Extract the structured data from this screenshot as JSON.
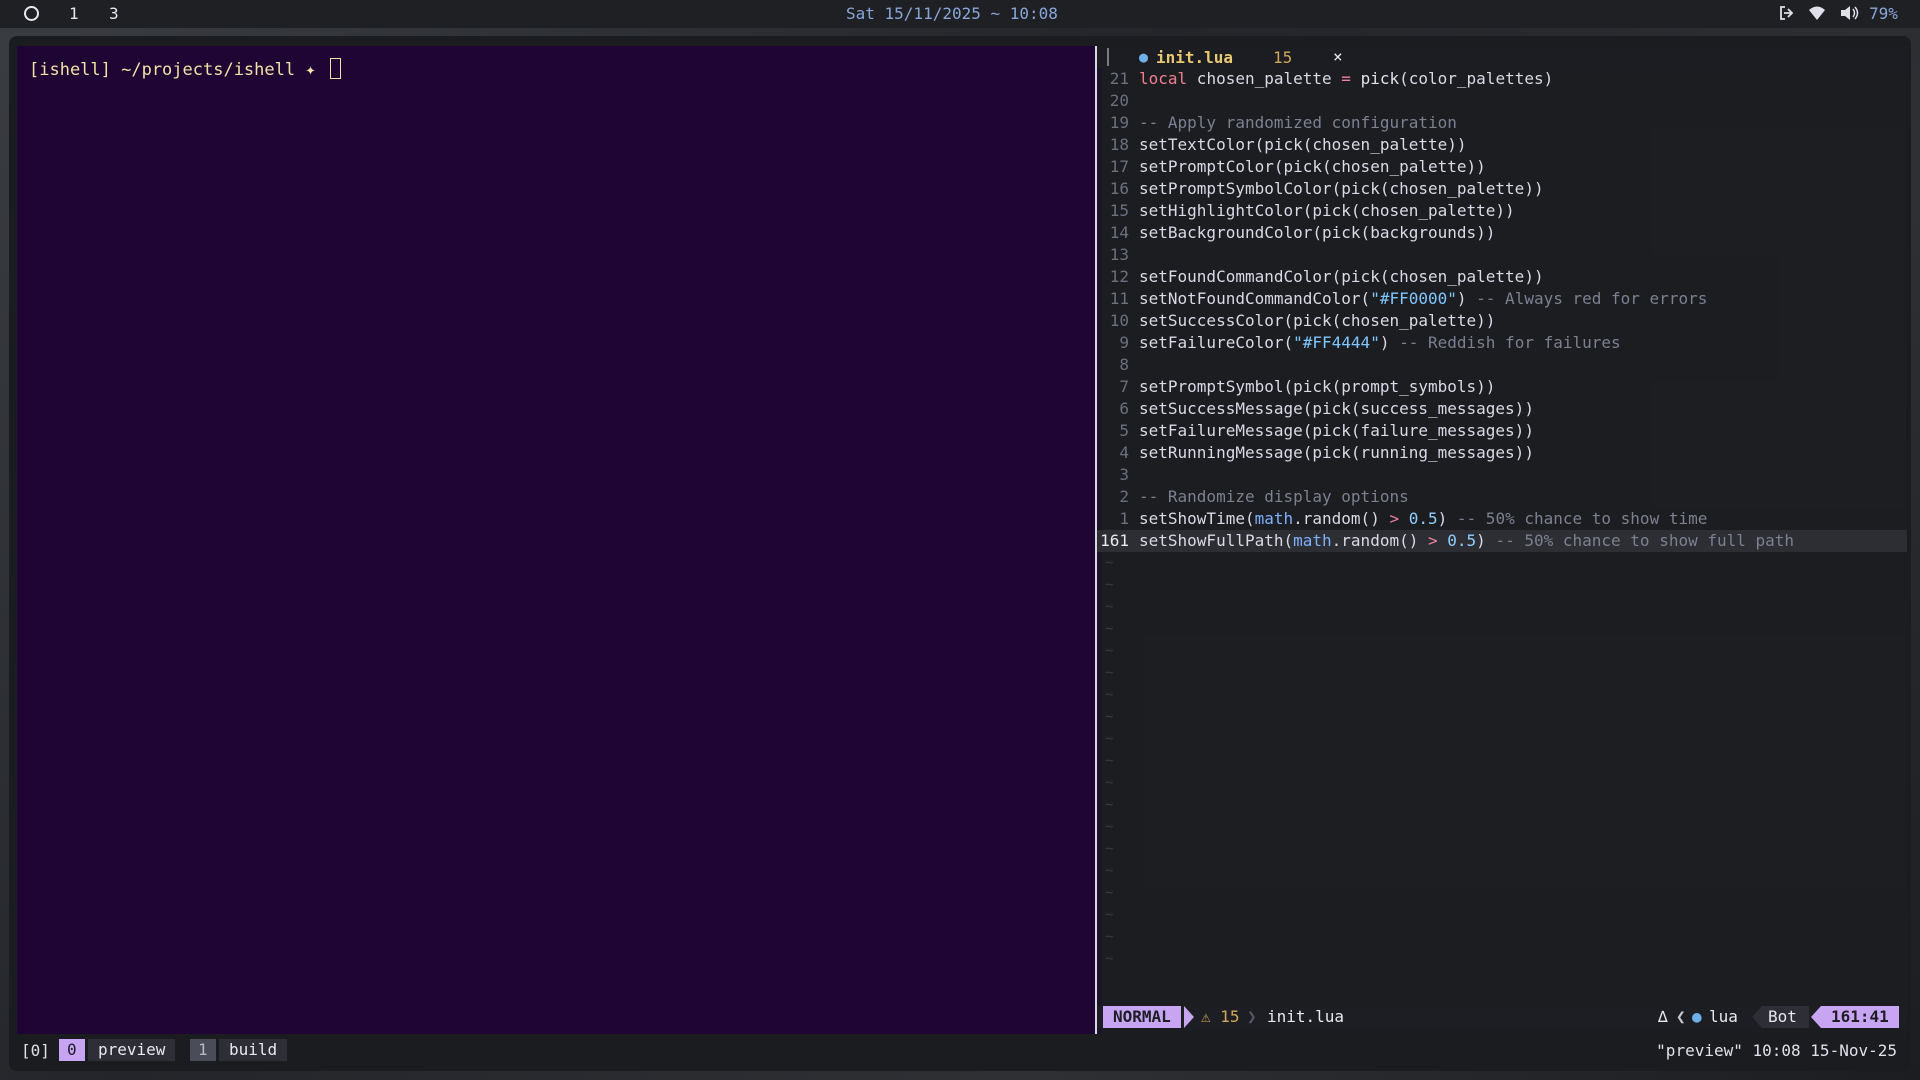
{
  "topbar": {
    "workspaces": [
      "1",
      "3"
    ],
    "clock": "Sat 15/11/2025 ~ 10:08",
    "battery": "79%",
    "tray_icons": [
      "logout-icon",
      "wifi-icon",
      "volume-icon"
    ]
  },
  "terminal": {
    "prompt": "[ishell] ~/projects/ishell ✦ "
  },
  "editor": {
    "tab": {
      "name": "init.lua",
      "diagnostics": "15",
      "close": "×"
    },
    "lines": [
      {
        "ln": "21",
        "code": "local chosen_palette = pick(color_palettes)"
      },
      {
        "ln": "20",
        "code": ""
      },
      {
        "ln": "19",
        "code": "-- Apply randomized configuration"
      },
      {
        "ln": "18",
        "code": "setTextColor(pick(chosen_palette))"
      },
      {
        "ln": "17",
        "code": "setPromptColor(pick(chosen_palette))"
      },
      {
        "ln": "16",
        "code": "setPromptSymbolColor(pick(chosen_palette))"
      },
      {
        "ln": "15",
        "code": "setHighlightColor(pick(chosen_palette))"
      },
      {
        "ln": "14",
        "code": "setBackgroundColor(pick(backgrounds))"
      },
      {
        "ln": "13",
        "code": ""
      },
      {
        "ln": "12",
        "code": "setFoundCommandColor(pick(chosen_palette))"
      },
      {
        "ln": "11",
        "code": "setNotFoundCommandColor(\"#FF0000\") -- Always red for errors"
      },
      {
        "ln": "10",
        "code": "setSuccessColor(pick(chosen_palette))"
      },
      {
        "ln": "9",
        "code": "setFailureColor(\"#FF4444\") -- Reddish for failures"
      },
      {
        "ln": "8",
        "code": ""
      },
      {
        "ln": "7",
        "code": "setPromptSymbol(pick(prompt_symbols))"
      },
      {
        "ln": "6",
        "code": "setSuccessMessage(pick(success_messages))"
      },
      {
        "ln": "5",
        "code": "setFailureMessage(pick(failure_messages))"
      },
      {
        "ln": "4",
        "code": "setRunningMessage(pick(running_messages))"
      },
      {
        "ln": "3",
        "code": ""
      },
      {
        "ln": "2",
        "code": "-- Randomize display options"
      },
      {
        "ln": "1",
        "code": "setShowTime(math.random() > 0.5) -- 50% chance to show time"
      },
      {
        "ln": "161",
        "code": "setShowFullPath(math.random() > 0.5) -- 50% chance to show full path",
        "current": true
      }
    ],
    "status": {
      "mode": "NORMAL",
      "warnings": "⚠ 15",
      "filename": "init.lua",
      "delta": "∆",
      "filetype": "lua",
      "scroll": "Bot",
      "position": "161:41"
    }
  },
  "tmux": {
    "session": "[0]",
    "windows": [
      {
        "index": "0",
        "name": "preview"
      },
      {
        "index": "1",
        "name": "build"
      }
    ],
    "right": "\"preview\" 10:08 15-Nov-25"
  }
}
